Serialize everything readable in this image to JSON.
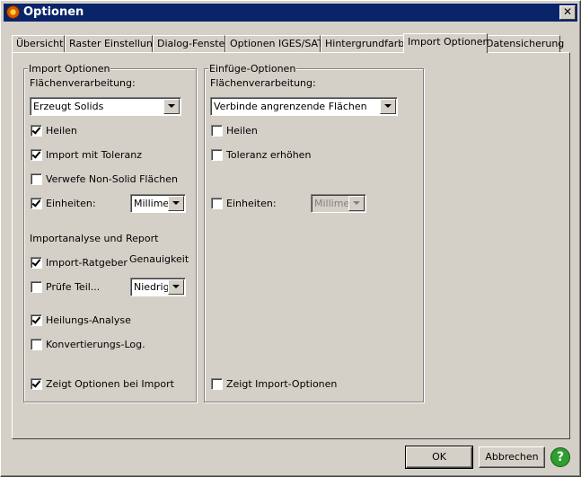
{
  "window": {
    "title": "Optionen",
    "close_label": "✕"
  },
  "tabs": [
    {
      "label": "Übersicht"
    },
    {
      "label": "Raster Einstellung"
    },
    {
      "label": "Dialog-Fenster"
    },
    {
      "label": "Optionen IGES/SAT"
    },
    {
      "label": "Hintergrundfarbe"
    },
    {
      "label": "Import Optionen",
      "active": true
    },
    {
      "label": "Datensicherung"
    }
  ],
  "import_group": {
    "title": "Import Optionen",
    "surface_label": "Flächenverarbeitung:",
    "surface_value": "Erzeugt Solids",
    "heal": {
      "label": "Heilen",
      "checked": true
    },
    "tolerance": {
      "label": "Import mit Toleranz",
      "checked": true
    },
    "discard": {
      "label": "Verwefe Non-Solid Flächen",
      "checked": false
    },
    "units": {
      "label": "Einheiten:",
      "checked": true,
      "value": "Millimeter"
    },
    "analysis_label": "Importanalyse und Report",
    "accuracy_label": "Genauigkeit",
    "advisor": {
      "label": "Import-Ratgeber",
      "checked": true
    },
    "check_part": {
      "label": "Prüfe Teil...",
      "checked": false
    },
    "accuracy_value": "Niedrig",
    "heal_analysis": {
      "label": "Heilungs-Analyse",
      "checked": true
    },
    "conv_log": {
      "label": "Konvertierungs-Log.",
      "checked": false
    },
    "show_options": {
      "label": "Zeigt Optionen bei Import",
      "checked": true
    }
  },
  "insert_group": {
    "title": "Einfüge-Optionen",
    "surface_label": "Flächenverarbeitung:",
    "surface_value": "Verbinde angrenzende Flächen",
    "heal": {
      "label": "Heilen",
      "checked": false
    },
    "tolerance": {
      "label": "Toleranz erhöhen",
      "checked": false
    },
    "units": {
      "label": "Einheiten:",
      "checked": false,
      "value": "Millimeter"
    },
    "show_options": {
      "label": "Zeigt Import-Optionen",
      "checked": false
    }
  },
  "footer": {
    "ok_label": "OK",
    "cancel_label": "Abbrechen",
    "help_label": "?"
  },
  "colors": {
    "titlebar": "#0a246a",
    "face": "#d4d0c8",
    "help": "#2e9e2e"
  }
}
